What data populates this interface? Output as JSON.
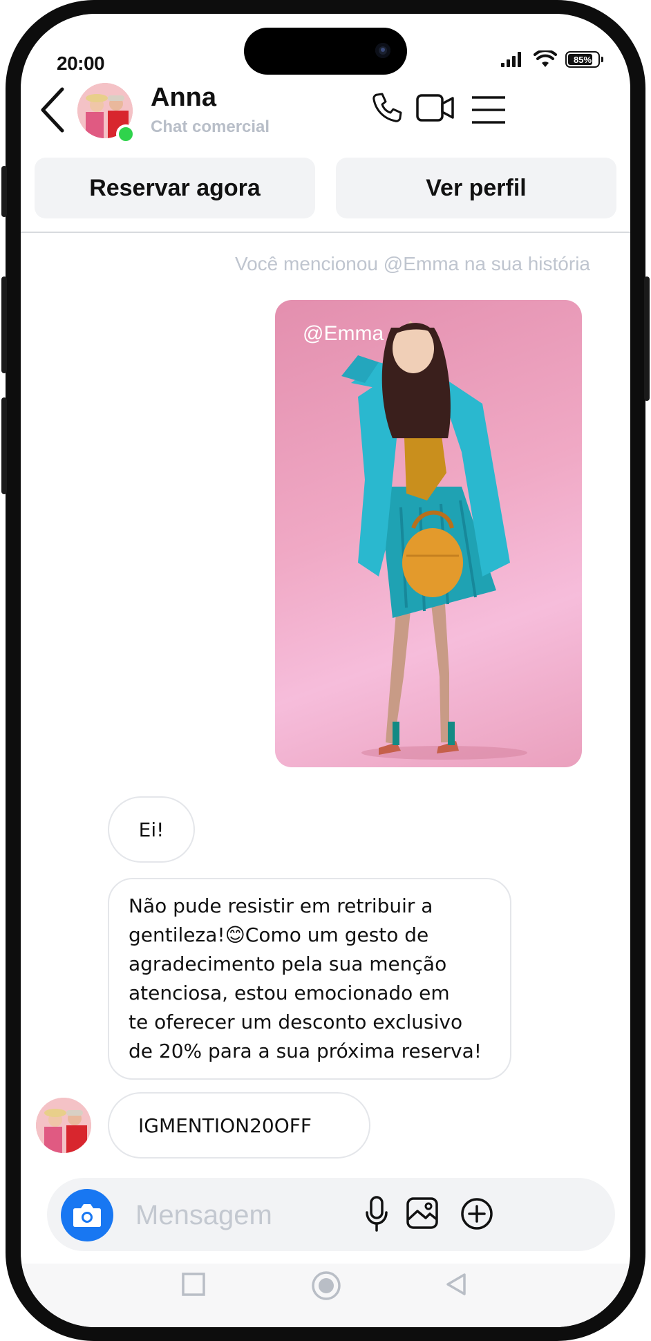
{
  "status_bar": {
    "time": "20:00",
    "battery_percent": "85%",
    "battery_level": 0.85
  },
  "header": {
    "name": "Anna",
    "subtitle": "Chat comercial",
    "online": true
  },
  "actions": {
    "book_label": "Reservar agora",
    "profile_label": "Ver perfil"
  },
  "messages": {
    "mention_note": "Você mencionou @Emma na sua história",
    "story_tag": "@Emma",
    "greeting": "Ei!",
    "offer_lines": [
      "Não pude resistir em retribuir a",
      "gentileza!😊Como um gesto de",
      "agradecimento pela sua menção",
      "atenciosa, estou emocionado em",
      "te oferecer um desconto exclusivo",
      "de 20% para a sua próxima reserva!"
    ],
    "code": "IGMENTION20OFF"
  },
  "composer": {
    "placeholder": "Mensagem"
  },
  "icons": {
    "back": "chevron-left-icon",
    "call": "phone-icon",
    "video": "video-camera-icon",
    "menu": "hamburger-menu-icon",
    "camera": "camera-icon",
    "mic": "microphone-icon",
    "gallery": "image-icon",
    "add": "plus-circle-icon",
    "nav_recent": "square-icon",
    "nav_home": "circle-icon",
    "nav_back": "triangle-back-icon"
  },
  "colors": {
    "accent": "#1877f2",
    "online": "#2fd34c",
    "story_bg": "#f0a9c5"
  }
}
